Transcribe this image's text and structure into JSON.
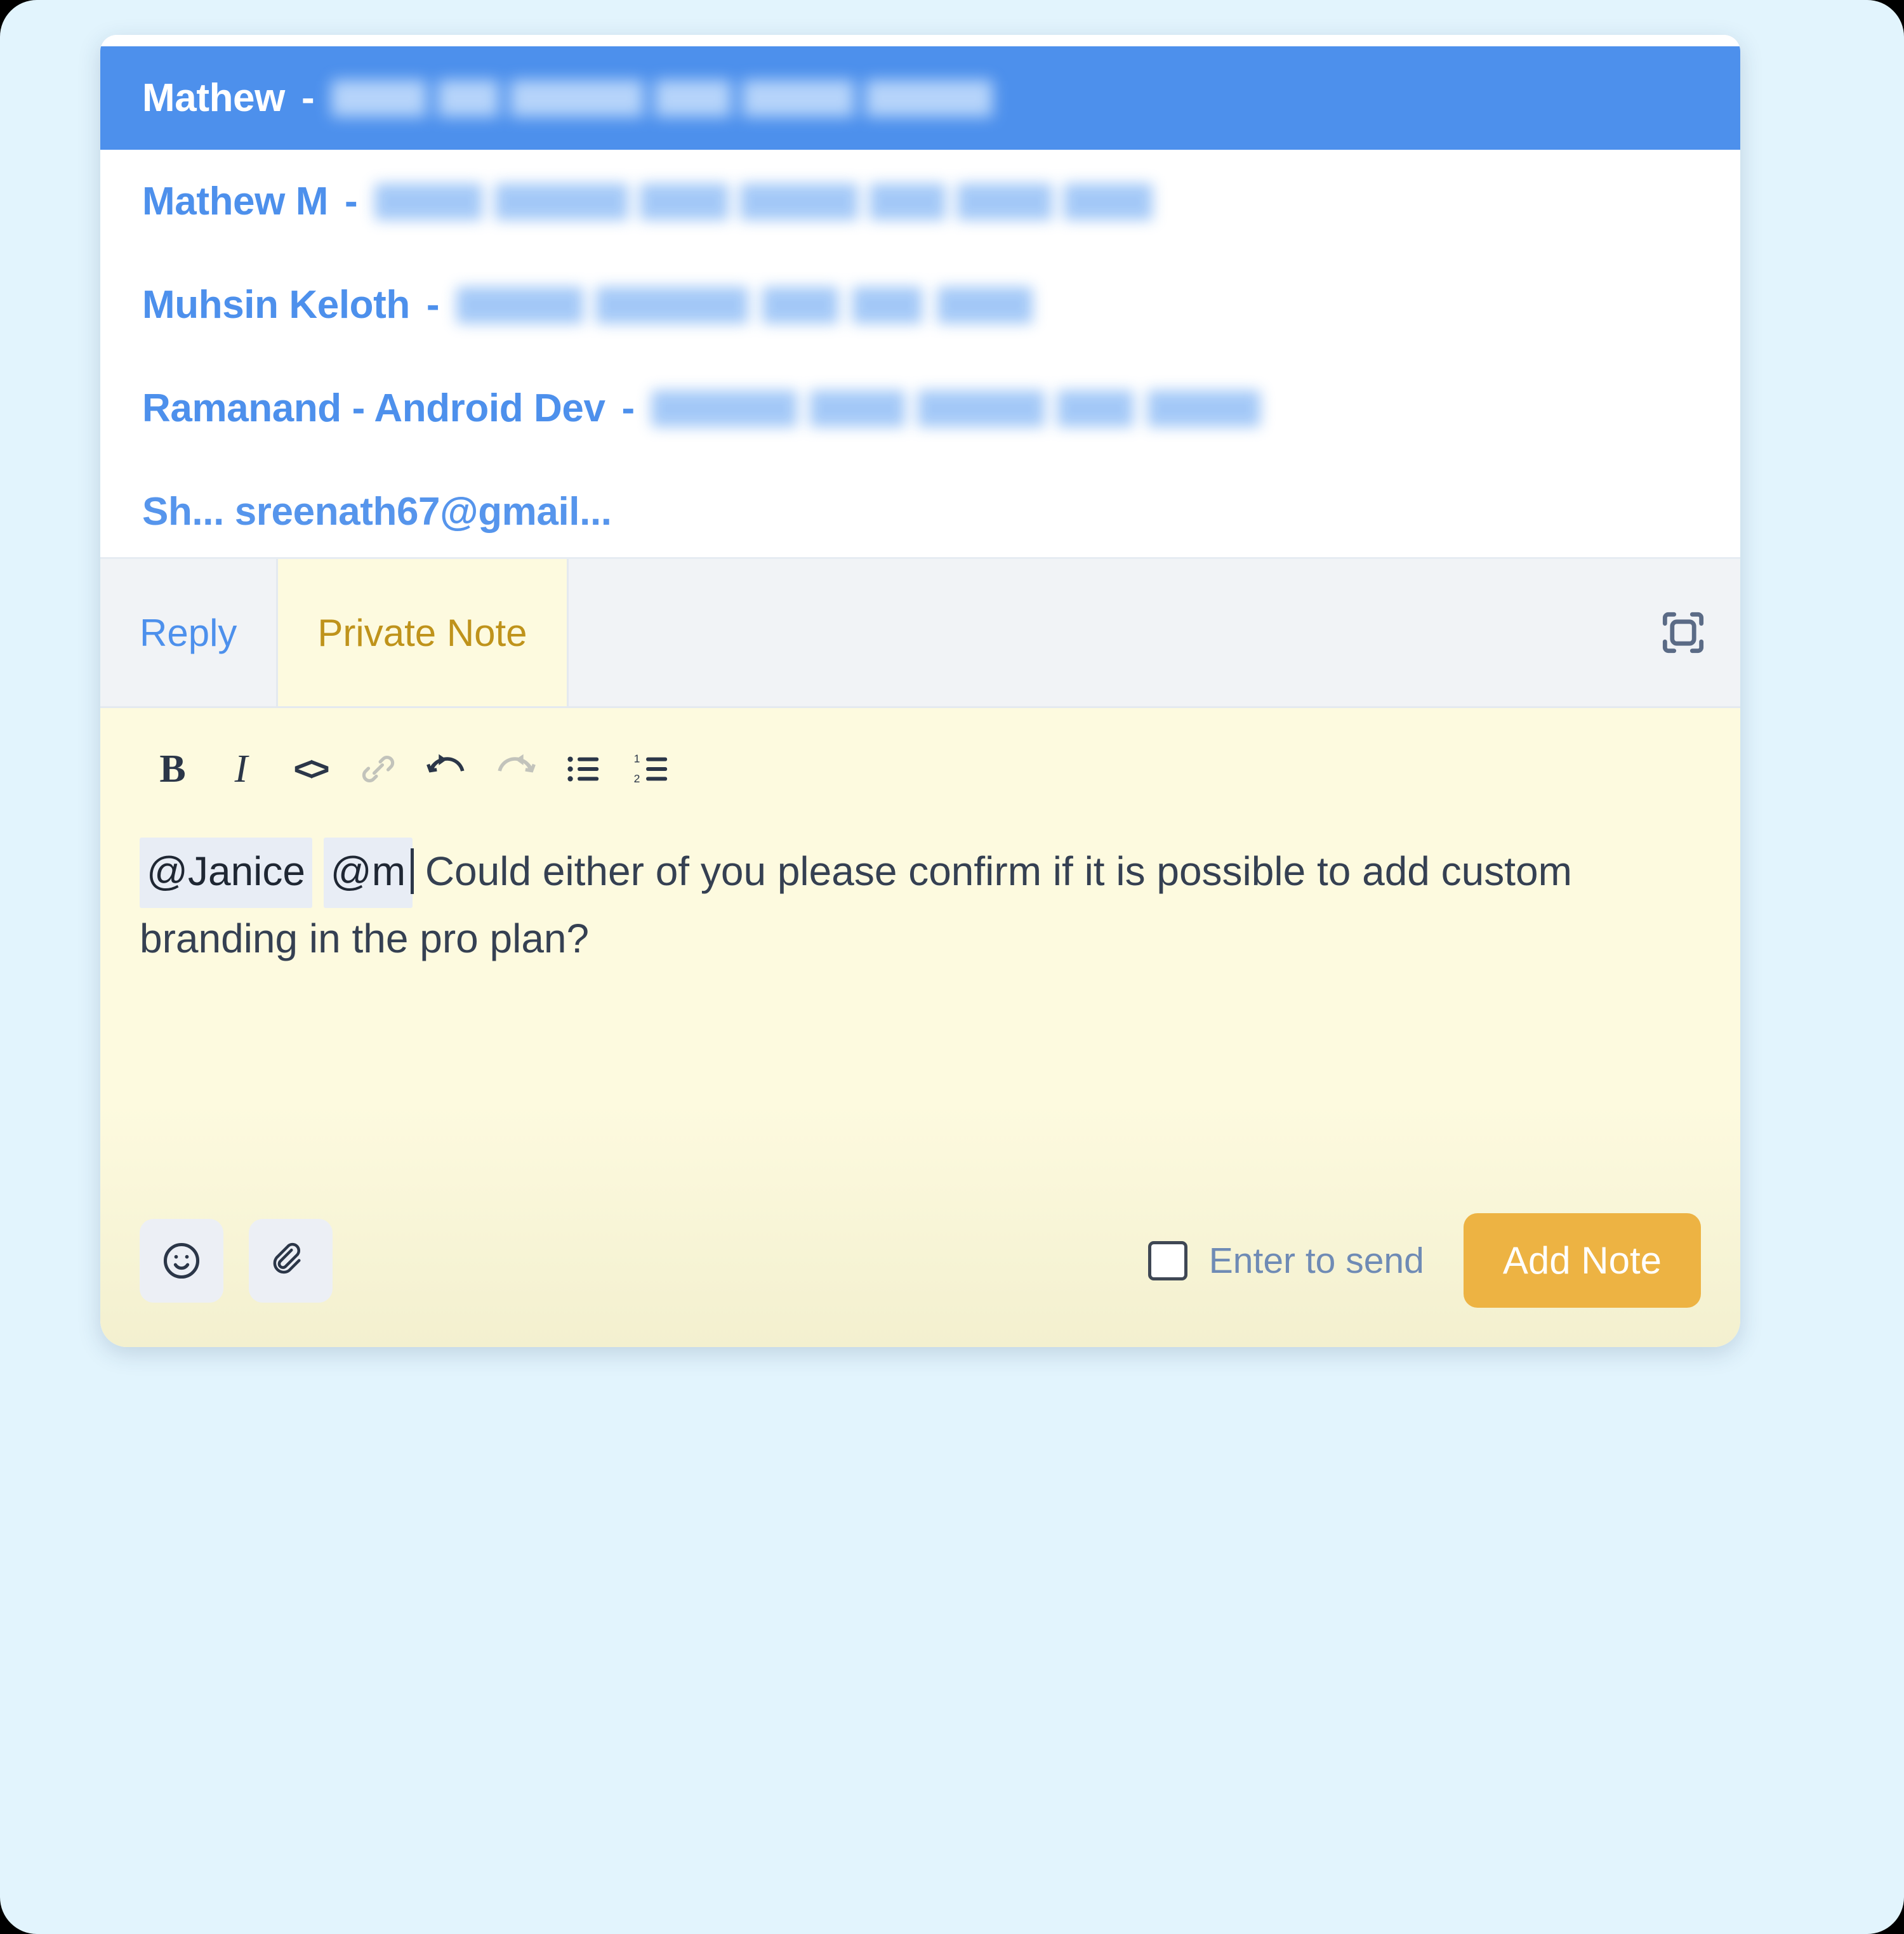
{
  "theme": {
    "page_background": "#e2f4fd",
    "panel_background": "#ffffff",
    "mention_blue": "#4d90ec",
    "note_yellow": "#fdfadf",
    "note_gold_text": "#bf931b",
    "add_note_amber": "#edb343",
    "body_text": "#354052",
    "checkbox_label_blue": "#6f8bb5"
  },
  "mention_dropdown": {
    "name": "mention-suggestions",
    "items": [
      {
        "name": "Mathew",
        "separator": "-",
        "email": "[redacted]",
        "selected": true,
        "email_width": 530,
        "clipped": false
      },
      {
        "name": "Mathew M",
        "separator": "-",
        "email": "[redacted]",
        "selected": false,
        "email_width": 630,
        "clipped": false
      },
      {
        "name": "Muhsin Keloth",
        "separator": "-",
        "email": "[redacted]",
        "selected": false,
        "email_width": 470,
        "clipped": false
      },
      {
        "name": "Ramanand - Android Dev",
        "separator": "-",
        "email": "[redacted]",
        "selected": false,
        "email_width": 500,
        "clipped": false
      },
      {
        "name": "Sh... sreenath67@gmail...",
        "separator": "",
        "email": "",
        "selected": false,
        "email_width": 0,
        "clipped": true
      }
    ]
  },
  "tabs": {
    "reply_label": "Reply",
    "note_label": "Private Note",
    "active": "Private Note",
    "expand_icon": "expand-icon"
  },
  "format_toolbar": {
    "buttons": [
      {
        "icon": "bold-icon",
        "label": "B",
        "enabled": true
      },
      {
        "icon": "italic-icon",
        "label": "I",
        "enabled": true
      },
      {
        "icon": "code-icon",
        "label": "<>",
        "enabled": true
      },
      {
        "icon": "link-icon",
        "label": "",
        "enabled": false
      },
      {
        "icon": "undo-icon",
        "label": "",
        "enabled": true
      },
      {
        "icon": "redo-icon",
        "label": "",
        "enabled": false
      },
      {
        "icon": "bullet-list-icon",
        "label": "",
        "enabled": true
      },
      {
        "icon": "numbered-list-icon",
        "label": "",
        "enabled": true
      }
    ]
  },
  "editor": {
    "mention_one": "@Janice",
    "mention_two": "@m",
    "body_text": "Could either of you please confirm if it is possible to add custom branding in the pro plan?"
  },
  "actions": {
    "emoji_icon": "emoji-icon",
    "attachment_icon": "paperclip-icon",
    "enter_to_send_label": "Enter to send",
    "enter_to_send_checked": false,
    "add_note_label": "Add Note"
  }
}
